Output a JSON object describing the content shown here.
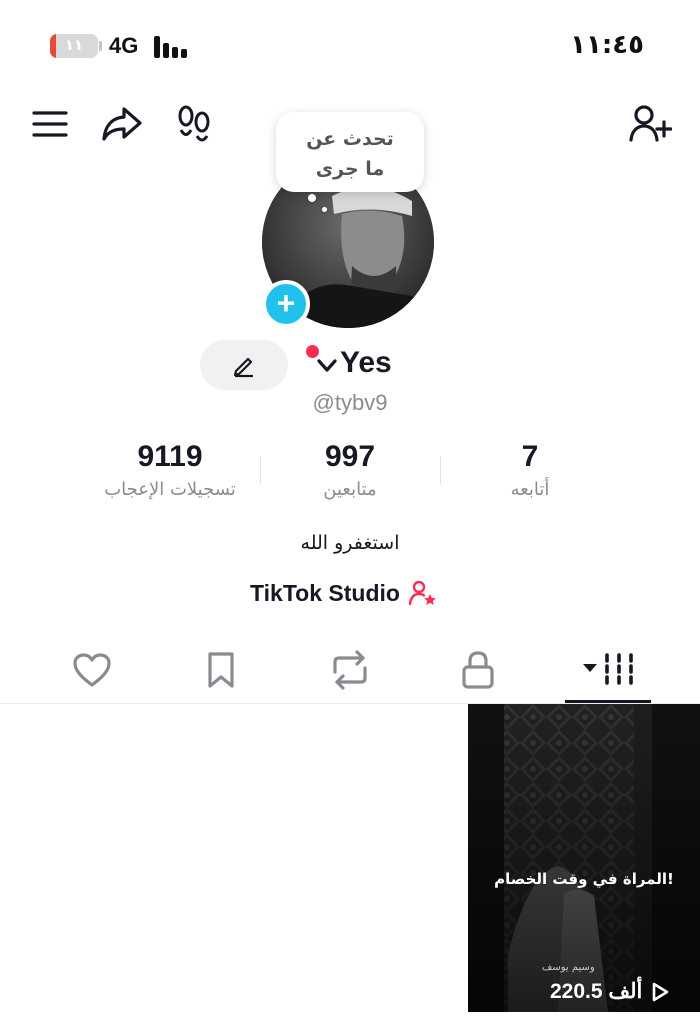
{
  "status_bar": {
    "battery_level": "١١",
    "battery_fraction": 0.12,
    "network": "4G",
    "time": "١١:٤٥"
  },
  "top_bar": {
    "icons": [
      "menu-icon",
      "share-icon",
      "footprints-icon",
      "add-friend-icon"
    ]
  },
  "profile": {
    "note_bubble": "تحدث عن ما جرى",
    "name": "Yes",
    "handle": "@tybv9",
    "bio": "استغفرو الله",
    "studio_link": "TikTok Studio"
  },
  "stats": [
    {
      "value": "7",
      "label": "أتابعه"
    },
    {
      "value": "997",
      "label": "متابعين"
    },
    {
      "value": "9119",
      "label": "تسجيلات الإعجاب"
    }
  ],
  "tabs": {
    "icons": [
      "heart-icon",
      "bookmark-icon",
      "repost-icon",
      "lock-icon",
      "grid-icon"
    ],
    "active": "grid-icon"
  },
  "video": {
    "caption": "المراة في وقت الخصام!",
    "small_text": "وسيم يوسف",
    "views": "220.5 ألف"
  },
  "colors": {
    "accent_blue": "#20c2ec",
    "accent_red": "#fe2c55",
    "text_primary": "#161823",
    "text_secondary": "#8a8b91"
  }
}
